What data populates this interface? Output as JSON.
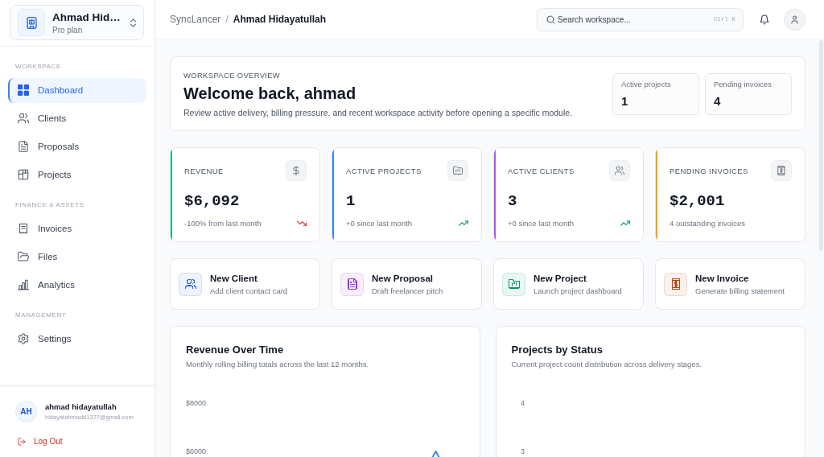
{
  "sidebar": {
    "workspace": {
      "name": "Ahmad Hid…",
      "plan": "Pro plan"
    },
    "sections": [
      {
        "label": "WORKSPACE",
        "items": [
          {
            "label": "Dashboard",
            "selected": true
          },
          {
            "label": "Clients",
            "selected": false
          },
          {
            "label": "Proposals",
            "selected": false
          },
          {
            "label": "Projects",
            "selected": false
          }
        ]
      },
      {
        "label": "FINANCE & ASSETS",
        "items": [
          {
            "label": "Invoices",
            "selected": false
          },
          {
            "label": "Files",
            "selected": false
          },
          {
            "label": "Analytics",
            "selected": false
          }
        ]
      },
      {
        "label": "MANAGEMENT",
        "items": [
          {
            "label": "Settings",
            "selected": false
          }
        ]
      }
    ],
    "user": {
      "initials": "AH",
      "name": "ahmad hidayatullah",
      "email": "hidayatahmadd1377@gmail.com"
    },
    "logout": "Log Out"
  },
  "header": {
    "breadcrumb": {
      "root": "SyncLancer",
      "separator": "/",
      "current": "Ahmad Hidayatullah"
    },
    "search": {
      "placeholder": "Search workspace...",
      "shortcut": "Ctrl K"
    }
  },
  "overview": {
    "eyebrow": "WORKSPACE OVERVIEW",
    "title": "Welcome back, ahmad",
    "description": "Review active delivery, billing pressure, and recent workspace activity before opening a specific module.",
    "metrics": [
      {
        "label": "Active projects",
        "value": "1"
      },
      {
        "label": "Pending invoices",
        "value": "4"
      }
    ]
  },
  "stats": [
    {
      "kind": "falling",
      "label": "REVENUE",
      "value": "$6,092",
      "note": "-100% from last month",
      "color": "#10b981"
    },
    {
      "kind": "rising",
      "label": "ACTIVE PROJECTS",
      "value": "1",
      "note": "+0 since last month",
      "color": "#3b82f6"
    },
    {
      "kind": "rising",
      "label": "ACTIVE CLIENTS",
      "value": "3",
      "note": "+0 since last month",
      "color": "#a855f7"
    },
    {
      "kind": "plain",
      "label": "PENDING INVOICES",
      "value": "$2,001",
      "note": "4 outstanding invoices",
      "color": "#f59e0b"
    }
  ],
  "quick_actions": [
    {
      "title": "New Client",
      "subtitle": "Add client contact card",
      "color": "#2563eb"
    },
    {
      "title": "New Proposal",
      "subtitle": "Draft freelancer pitch",
      "color": "#9333ea"
    },
    {
      "title": "New Project",
      "subtitle": "Launch project dashboard",
      "color": "#059669"
    },
    {
      "title": "New Invoice",
      "subtitle": "Generate billing statement",
      "color": "#c2410c"
    }
  ],
  "charts": [
    {
      "kind": "line",
      "title": "Revenue Over Time",
      "subtitle": "Monthly rolling billing totals across the last 12 months.",
      "axis_labels": [
        "$8000",
        "$6000"
      ]
    },
    {
      "kind": "bar",
      "title": "Projects by Status",
      "subtitle": "Current project count distribution across delivery stages.",
      "axis_labels": [
        "4",
        "3"
      ]
    }
  ]
}
